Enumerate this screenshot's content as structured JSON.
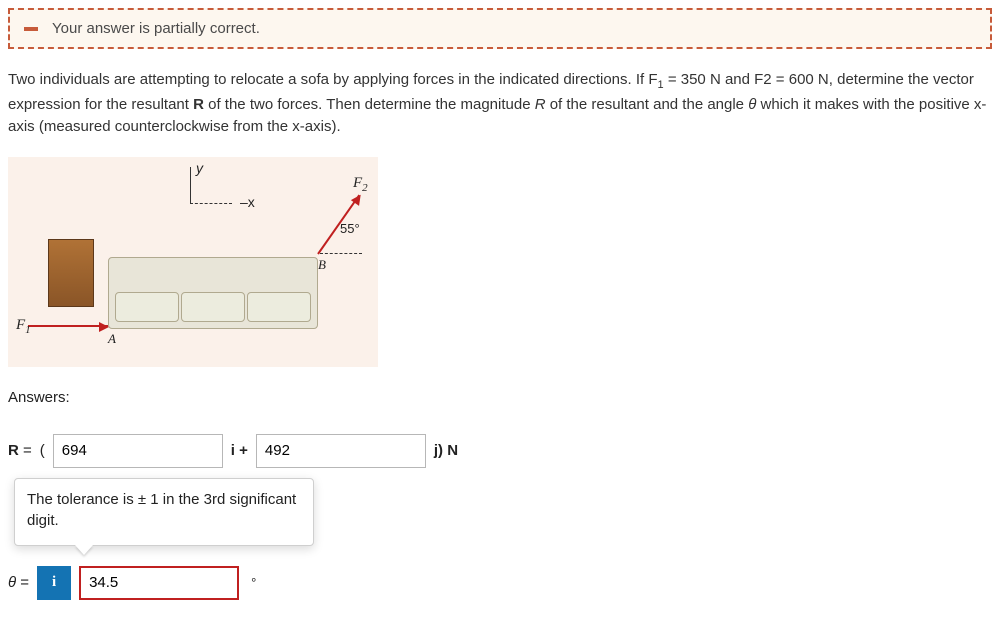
{
  "alert": {
    "message": "Your answer is partially correct."
  },
  "problem": {
    "text_before_f1": "Two individuals are attempting to relocate a sofa by applying forces in the indicated directions. If F",
    "f1_sub": "1",
    "text_mid1": " = 350 N and F2 = 600 N, determine the vector expression for the resultant ",
    "bold_R": "R",
    "text_mid2": " of the two forces. Then determine the magnitude ",
    "italic_R": "R",
    "text_mid3": " of the resultant and the angle ",
    "theta": "θ",
    "text_end": " which it makes with the positive x-axis (measured counterclockwise from the x-axis)."
  },
  "diagram": {
    "y": "y",
    "x": "–x",
    "f1": "F",
    "f1sub": "1",
    "f2": "F",
    "f2sub": "2",
    "angle": "55°",
    "A": "A",
    "B": "B"
  },
  "answers": {
    "heading": "Answers:",
    "R_label": "R",
    "equals": " = ",
    "paren_open": "(",
    "i_value": "694",
    "i_plus": "i +",
    "j_value": "492",
    "j_close": "j) N",
    "tolerance": "The tolerance is ± 1 in the 3rd significant digit.",
    "theta_label": "θ",
    "theta_eq": " = ",
    "info": "i",
    "theta_value": "34.5",
    "deg": "°"
  }
}
